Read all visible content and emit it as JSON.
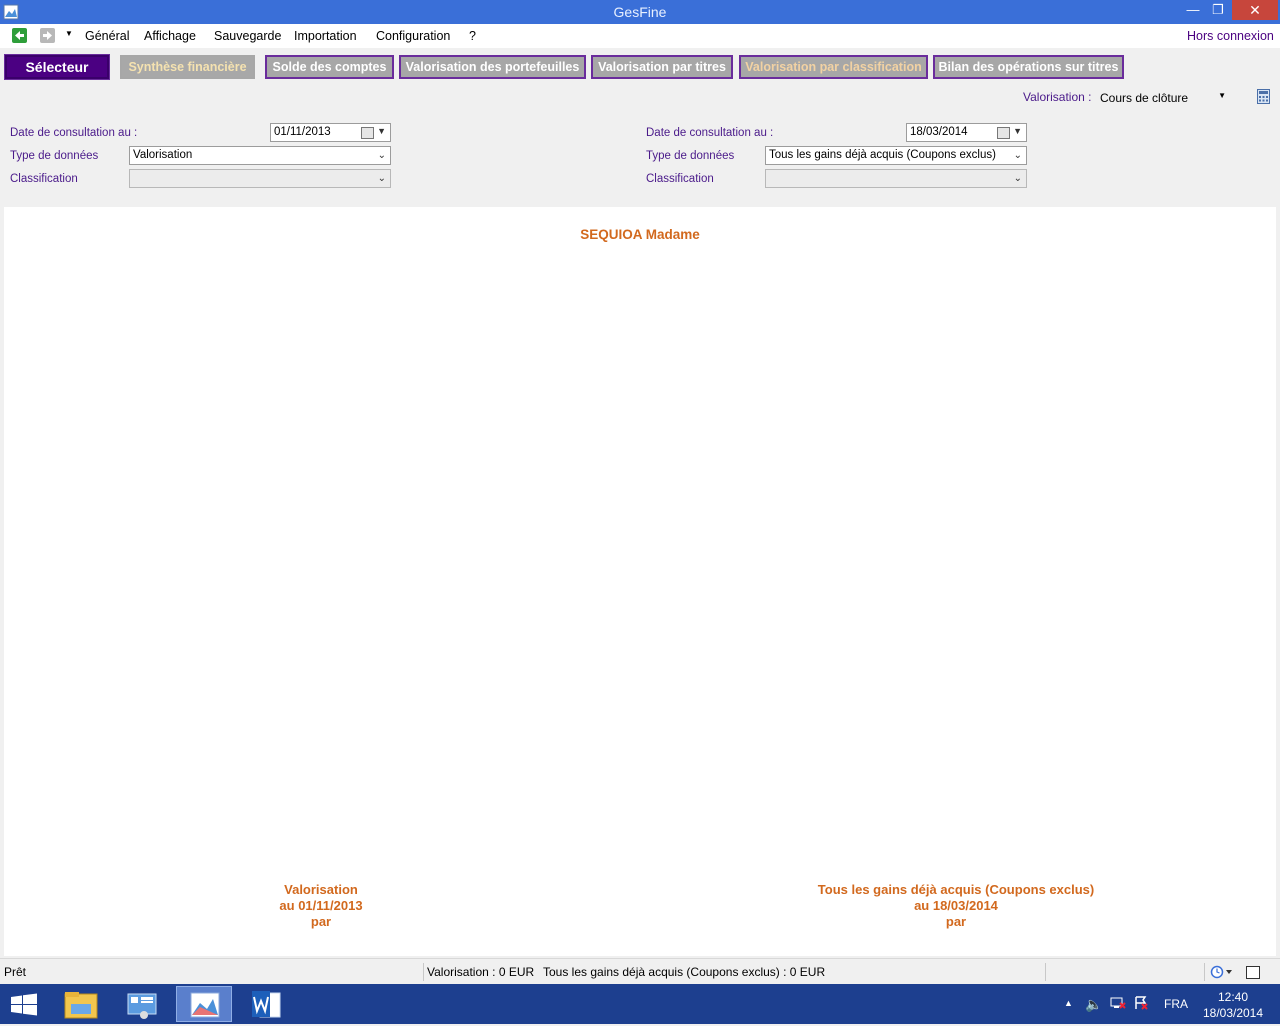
{
  "window": {
    "title": "GesFine"
  },
  "menu": {
    "items": [
      "Général",
      "Affichage",
      "Sauvegarde",
      "Importation",
      "Configuration",
      "?"
    ],
    "right_link": "Hors connexion"
  },
  "nav": {
    "selecteur": "Sélecteur",
    "synthese": "Synthèse financière",
    "solde": "Solde des comptes",
    "portefeuilles": "Valorisation des portefeuilles",
    "titres": "Valorisation par titres",
    "classification": "Valorisation par classification",
    "bilan": "Bilan des opérations sur titres"
  },
  "valorisation": {
    "label": "Valorisation :",
    "value": "Cours de clôture"
  },
  "left_form": {
    "date_label": "Date de consultation au :",
    "date_value": "01/11/2013",
    "type_label": "Type de données",
    "type_value": "Valorisation",
    "class_label": "Classification",
    "class_value": ""
  },
  "right_form": {
    "date_label": "Date de consultation au :",
    "date_value": "18/03/2014",
    "type_label": "Type de données",
    "type_value": "Tous les gains déjà acquis (Coupons exclus)",
    "class_label": "Classification",
    "class_value": ""
  },
  "content": {
    "title": "SEQUIOA Madame",
    "left_caption": [
      "Valorisation",
      "au 01/11/2013",
      "par"
    ],
    "right_caption": [
      "Tous les gains déjà acquis (Coupons exclus)",
      "au 18/03/2014",
      "par"
    ]
  },
  "status": {
    "ready": "Prêt",
    "valorisation": "Valorisation : 0 EUR",
    "gains": "Tous les gains déjà acquis (Coupons exclus) : 0 EUR"
  },
  "taskbar": {
    "language": "FRA",
    "time": "12:40",
    "date": "18/03/2014"
  },
  "colors": {
    "accent": "#4b0082",
    "caption": "#d2691e",
    "titlebar": "#3a6fd8"
  }
}
